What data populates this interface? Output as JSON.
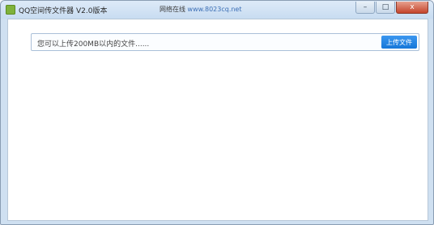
{
  "window": {
    "title": "QQ空间传文件器 V2.0版本",
    "ad_label": "网络在线",
    "ad_url": "www.8023cq.net",
    "controls": {
      "minimize": "–",
      "maximize": "□",
      "close": "x"
    }
  },
  "upload": {
    "prompt": "您可以上传200MB以内的文件......",
    "button_label": "上传文件"
  }
}
